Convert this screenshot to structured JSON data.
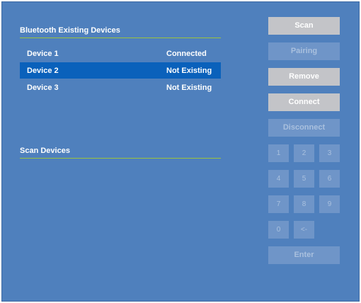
{
  "existing": {
    "title": "Bluetooth Existing Devices",
    "devices": [
      {
        "name": "Device 1",
        "status": "Connected"
      },
      {
        "name": "Device 2",
        "status": "Not Existing"
      },
      {
        "name": "Device 3",
        "status": "Not Existing"
      }
    ]
  },
  "scan": {
    "title": "Scan Devices"
  },
  "buttons": {
    "scan": "Scan",
    "pairing": "Pairing",
    "remove": "Remove",
    "connect": "Connect",
    "disconnect": "Disconnect",
    "enter": "Enter"
  },
  "keypad": {
    "k1": "1",
    "k2": "2",
    "k3": "3",
    "k4": "4",
    "k5": "5",
    "k6": "6",
    "k7": "7",
    "k8": "8",
    "k9": "9",
    "k0": "0",
    "back": "<-"
  },
  "colors": {
    "panel": "#4f80bd",
    "selected_row": "#0a61bb",
    "accent_line": "#9cc23e",
    "enabled_button": "#c3c4c8",
    "disabled_button": "#6f95c8"
  }
}
